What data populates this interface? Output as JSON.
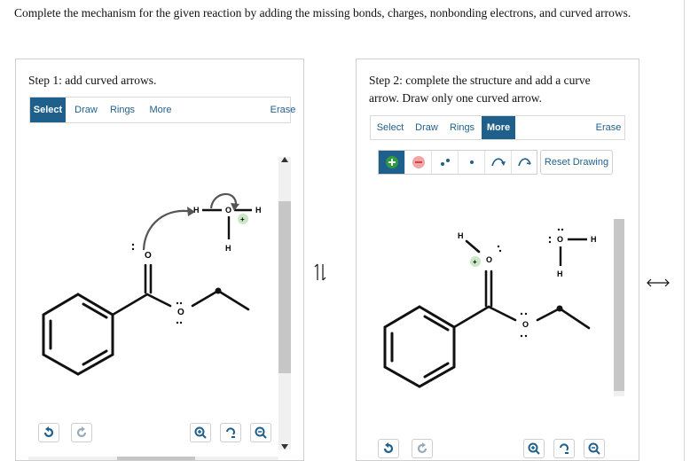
{
  "question": "Complete the mechanism for the given reaction by adding the missing bonds, charges, nonbonding electrons, and curved arrows.",
  "step1": {
    "title": "Step 1: add curved arrows.",
    "toolbar": {
      "select": "Select",
      "draw": "Draw",
      "rings": "Rings",
      "more": "More",
      "erase": "Erase"
    },
    "atoms": {
      "o_carbonyl": "O",
      "o_ester": "O",
      "h_water_left": "H",
      "o_water": "O",
      "h_water_bottom": "H",
      "h_water_right": "H",
      "charge": "+"
    }
  },
  "step2": {
    "title_line1": "Step 2: complete the structure and add a curve",
    "title_line2": "arrow. Draw only one curved arrow.",
    "toolbar": {
      "select": "Select",
      "draw": "Draw",
      "rings": "Rings",
      "more": "More",
      "erase": "Erase"
    },
    "reset": "Reset Drawing",
    "atoms": {
      "h_protonated": "H",
      "o_carbonyl": "O",
      "o_ester": "O",
      "o_water": "O",
      "h_water_right": "H",
      "h_water_bottom": "H",
      "charge": "+"
    }
  },
  "equilibrium_symbol": "⇌",
  "colors": {
    "accent": "#1f5f8b",
    "charge_green": "#c9e8c4",
    "charge_red": "#f2a5a5",
    "plus_green": "#2e9b3e"
  }
}
